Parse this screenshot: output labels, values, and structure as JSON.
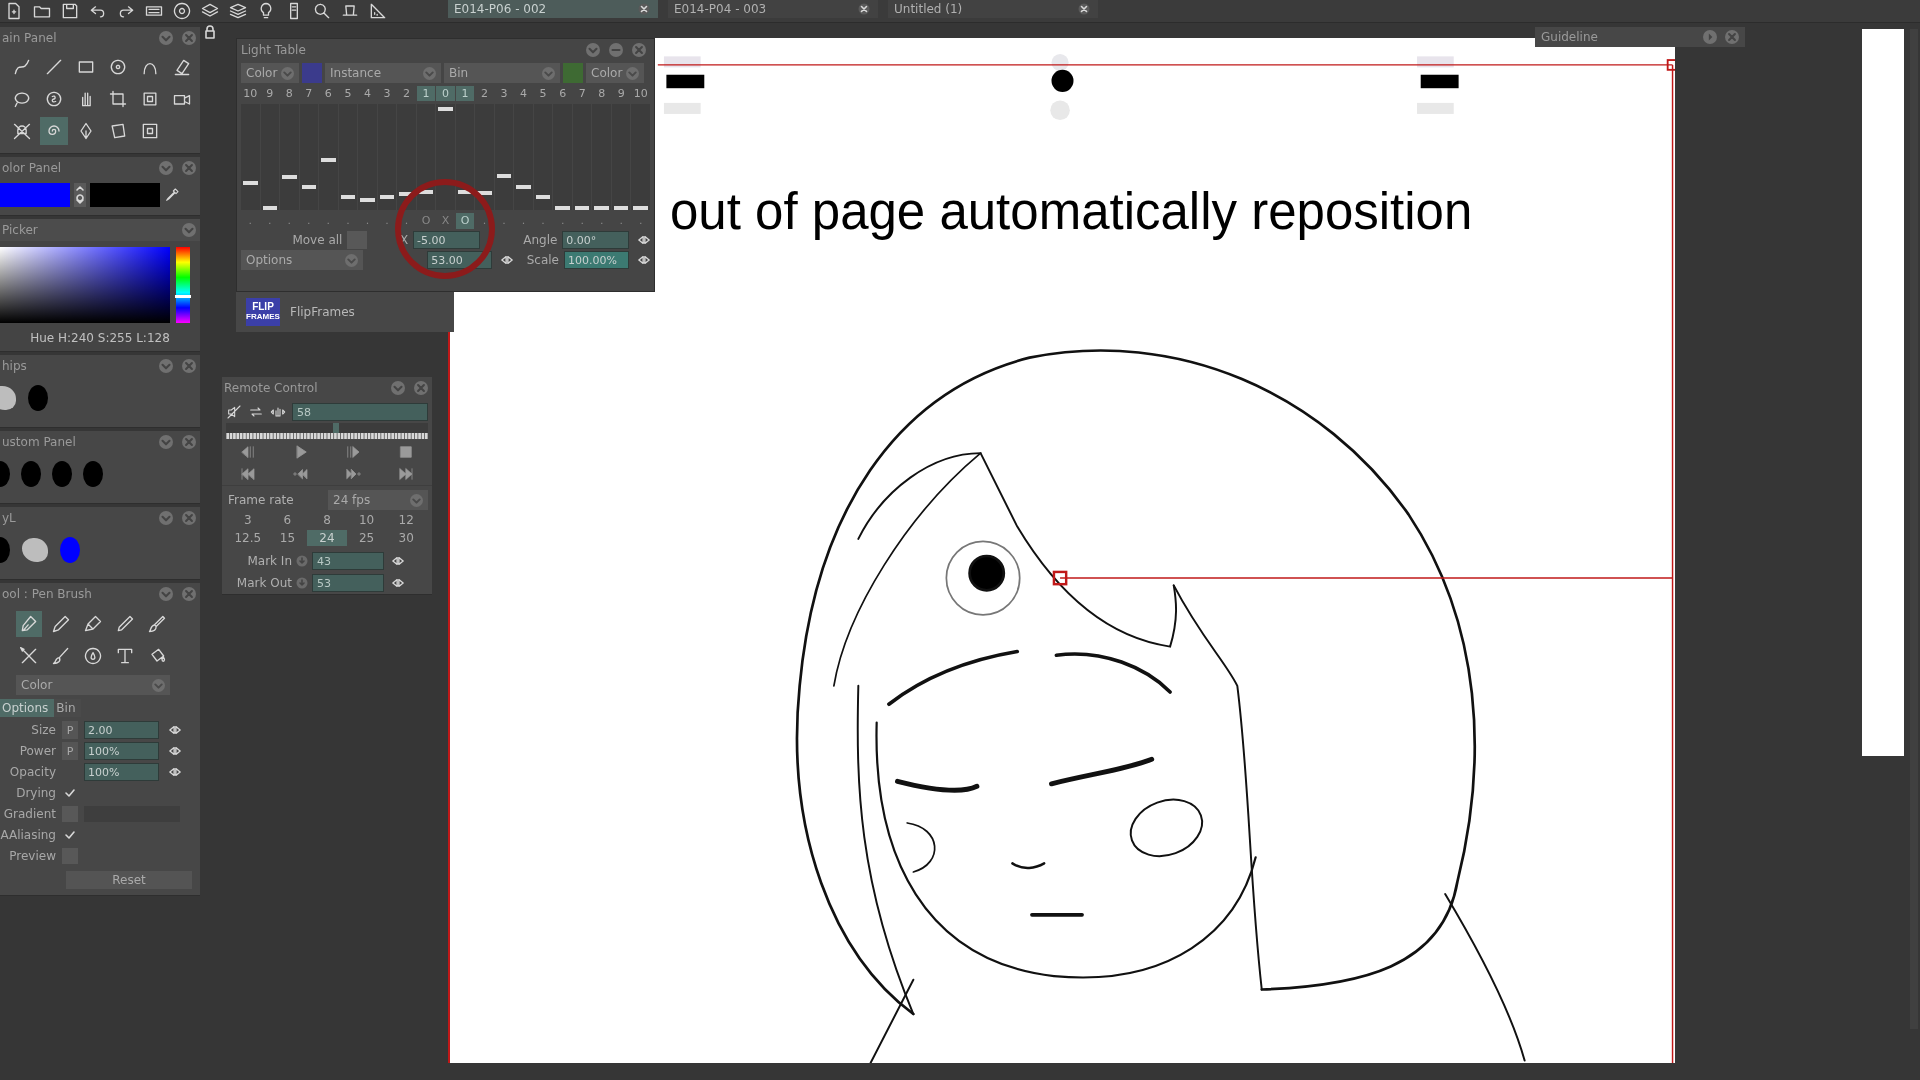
{
  "tabs": [
    {
      "label": "E014-P06 - 002",
      "selected": true
    },
    {
      "label": "E014-P04 - 003",
      "selected": false
    },
    {
      "label": "Untitled (1)",
      "selected": false
    }
  ],
  "main_panel": {
    "title": "ain Panel",
    "tools": [
      {
        "selected": false
      },
      {
        "selected": false
      },
      {
        "selected": false
      },
      {
        "selected": false
      },
      {
        "selected": false
      },
      {
        "selected": false
      },
      {
        "selected": false
      },
      {
        "selected": false
      },
      {
        "selected": false
      },
      {
        "selected": false
      },
      {
        "selected": false
      },
      {
        "selected": false
      },
      {
        "selected": false
      },
      {
        "selected": true
      },
      {
        "selected": false
      },
      {
        "selected": false
      },
      {
        "selected": false
      }
    ]
  },
  "color_panel": {
    "title": "olor Panel",
    "swatches": [
      {
        "color": "#0000ff"
      },
      {
        "color": "#000000"
      }
    ]
  },
  "picker": {
    "title": "Picker",
    "hue": {
      "level": 0.33
    },
    "readout": "Hue H:240 S:255 L:128"
  },
  "chips": {
    "title": "hips",
    "items": [
      {
        "kind": "blob",
        "color": "#bdbdbd"
      },
      {
        "kind": "dot",
        "color": "#000000"
      }
    ]
  },
  "custom_panel": {
    "title": "ustom Panel",
    "items": [
      {
        "kind": "dot",
        "color": "#000000"
      },
      {
        "kind": "dot",
        "color": "#000000"
      },
      {
        "kind": "dot",
        "color": "#000000"
      },
      {
        "kind": "dot",
        "color": "#000000"
      }
    ]
  },
  "style_panel": {
    "title": "yL",
    "items": [
      {
        "kind": "dot",
        "color": "#000000"
      },
      {
        "kind": "blob",
        "color": "#bdbdbd"
      },
      {
        "kind": "dot",
        "color": "#0000ff"
      }
    ]
  },
  "tool_panel": {
    "title": "ool : Pen Brush",
    "brushes": [
      {
        "selected": true
      },
      {
        "selected": false
      },
      {
        "selected": false
      },
      {
        "selected": false
      },
      {
        "selected": false
      },
      {
        "selected": false
      },
      {
        "selected": false
      },
      {
        "selected": false
      },
      {
        "selected": false
      },
      {
        "selected": false
      }
    ],
    "mode": "Color",
    "tabs": [
      {
        "label": "Options",
        "selected": true
      },
      {
        "label": "Bin",
        "selected": false
      }
    ],
    "settings": [
      {
        "kind": "field",
        "label": "Size",
        "pressure": "P",
        "value": "2.00"
      },
      {
        "kind": "field",
        "label": "Power",
        "pressure": "P",
        "value": "100%"
      },
      {
        "kind": "field",
        "label": "Opacity",
        "value": "100%"
      },
      {
        "kind": "check",
        "label": "Drying",
        "checked": true
      },
      {
        "kind": "gradient",
        "label": "Gradient",
        "checked": false
      },
      {
        "kind": "check",
        "label": "AAliasing",
        "checked": true
      },
      {
        "kind": "check",
        "label": "Preview",
        "checked": false
      }
    ],
    "reset": "Reset"
  },
  "light_table": {
    "title": "Light Table",
    "selectors": [
      {
        "kind": "dropdown",
        "value": "Color"
      },
      {
        "kind": "swatch",
        "color": "#3b3b8c"
      },
      {
        "kind": "dropdown",
        "value": "Instance"
      },
      {
        "kind": "dropdown",
        "value": "Bin"
      },
      {
        "kind": "swatch",
        "color": "#3e6a33"
      },
      {
        "kind": "dropdown",
        "value": "Color"
      }
    ],
    "frames": [
      {
        "label": "10",
        "selected": false,
        "level": 0.25,
        "mark": ".",
        "mark_on": false
      },
      {
        "label": "9",
        "selected": false,
        "level": 0.0,
        "mark": ".",
        "mark_on": false
      },
      {
        "label": "8",
        "selected": false,
        "level": 0.3,
        "mark": ".",
        "mark_on": false
      },
      {
        "label": "7",
        "selected": false,
        "level": 0.21,
        "mark": ".",
        "mark_on": false
      },
      {
        "label": "6",
        "selected": false,
        "level": 0.47,
        "mark": ".",
        "mark_on": false
      },
      {
        "label": "5",
        "selected": false,
        "level": 0.11,
        "mark": ".",
        "mark_on": false
      },
      {
        "label": "4",
        "selected": false,
        "level": 0.08,
        "mark": ".",
        "mark_on": false
      },
      {
        "label": "3",
        "selected": false,
        "level": 0.11,
        "mark": ".",
        "mark_on": false
      },
      {
        "label": "2",
        "selected": false,
        "level": 0.14,
        "mark": ".",
        "mark_on": false
      },
      {
        "label": "1",
        "selected": true,
        "level": 0.16,
        "mark": "O",
        "mark_on": false
      },
      {
        "label": "0",
        "selected": true,
        "level": 0.97,
        "mark": "X",
        "mark_on": false
      },
      {
        "label": "1",
        "selected": true,
        "level": 0.16,
        "mark": "O",
        "mark_on": true
      },
      {
        "label": "2",
        "selected": false,
        "level": 0.15,
        "mark": ".",
        "mark_on": false
      },
      {
        "label": "3",
        "selected": false,
        "level": 0.31,
        "mark": ".",
        "mark_on": false
      },
      {
        "label": "4",
        "selected": false,
        "level": 0.21,
        "mark": ".",
        "mark_on": false
      },
      {
        "label": "5",
        "selected": false,
        "level": 0.11,
        "mark": ".",
        "mark_on": false
      },
      {
        "label": "6",
        "selected": false,
        "level": 0.0,
        "mark": ".",
        "mark_on": false
      },
      {
        "label": "7",
        "selected": false,
        "level": 0.0,
        "mark": ".",
        "mark_on": false
      },
      {
        "label": "8",
        "selected": false,
        "level": 0.0,
        "mark": ".",
        "mark_on": false
      },
      {
        "label": "9",
        "selected": false,
        "level": 0.0,
        "mark": ".",
        "mark_on": false
      },
      {
        "label": "10",
        "selected": false,
        "level": 0.0,
        "mark": ".",
        "mark_on": false
      }
    ],
    "move_all": {
      "label": "Move all",
      "checked": false
    },
    "options": "Options",
    "x": {
      "label": "X",
      "value": "-5.00"
    },
    "y": {
      "value": "53.00"
    },
    "angle": {
      "label": "Angle",
      "value": "0.00°"
    },
    "scale": {
      "label": "Scale",
      "value": "100.00%"
    }
  },
  "flipframes": {
    "logo_top": "FLIP",
    "logo_bottom": "FRAMES",
    "label": "FlipFrames"
  },
  "remote_control": {
    "title": "Remote Control",
    "frame": "58",
    "scrub": {
      "level": 0.53
    },
    "frame_rate": {
      "label": "Frame rate",
      "value": "24 fps"
    },
    "rates": [
      {
        "label": "3",
        "selected": false
      },
      {
        "label": "6",
        "selected": false
      },
      {
        "label": "8",
        "selected": false
      },
      {
        "label": "10",
        "selected": false
      },
      {
        "label": "12",
        "selected": false
      },
      {
        "label": "12.5",
        "selected": false
      },
      {
        "label": "15",
        "selected": false
      },
      {
        "label": "24",
        "selected": true
      },
      {
        "label": "25",
        "selected": false
      },
      {
        "label": "30",
        "selected": false
      }
    ],
    "marks": [
      {
        "label": "Mark In",
        "value": "43"
      },
      {
        "label": "Mark Out",
        "value": "53"
      }
    ]
  },
  "canvas": {
    "caption": "out of page automatically reposition"
  },
  "guideline": {
    "title": "Guideline"
  }
}
